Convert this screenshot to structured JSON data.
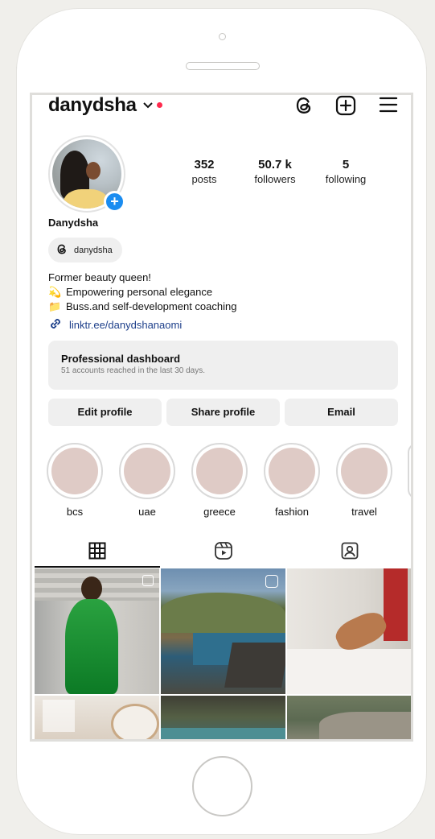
{
  "profile": {
    "username": "danydsha",
    "full_name": "Danydsha",
    "threads_handle": "danydsha",
    "stats": [
      {
        "value": "352",
        "label": "posts"
      },
      {
        "value": "50.7 k",
        "label": "followers"
      },
      {
        "value": "5",
        "label": "following"
      }
    ],
    "bio": [
      {
        "icon": "",
        "text": "Former beauty queen!"
      },
      {
        "icon": "💫",
        "text": "Empowering personal elegance"
      },
      {
        "icon": "📁",
        "text": "Buss.and self-development coaching"
      }
    ],
    "link": "linktr.ee/danydshanaomi"
  },
  "dashboard": {
    "title": "Professional dashboard",
    "subtitle": "51 accounts reached in the last 30 days."
  },
  "buttons": {
    "edit": "Edit profile",
    "share": "Share profile",
    "email": "Email"
  },
  "highlights": [
    "bcs",
    "uae",
    "greece",
    "fashion",
    "travel"
  ],
  "icons": {
    "header": [
      "threads-icon",
      "new-post-icon",
      "menu-icon"
    ],
    "tabs": [
      "grid-icon",
      "reels-icon",
      "tagged-icon"
    ],
    "add_badge": "+"
  },
  "colors": {
    "notification_dot": "#ff2a4d",
    "add_badge": "#1a8cf0",
    "link": "#1d3f8a",
    "highlight_fill": "#dfcbc6"
  }
}
